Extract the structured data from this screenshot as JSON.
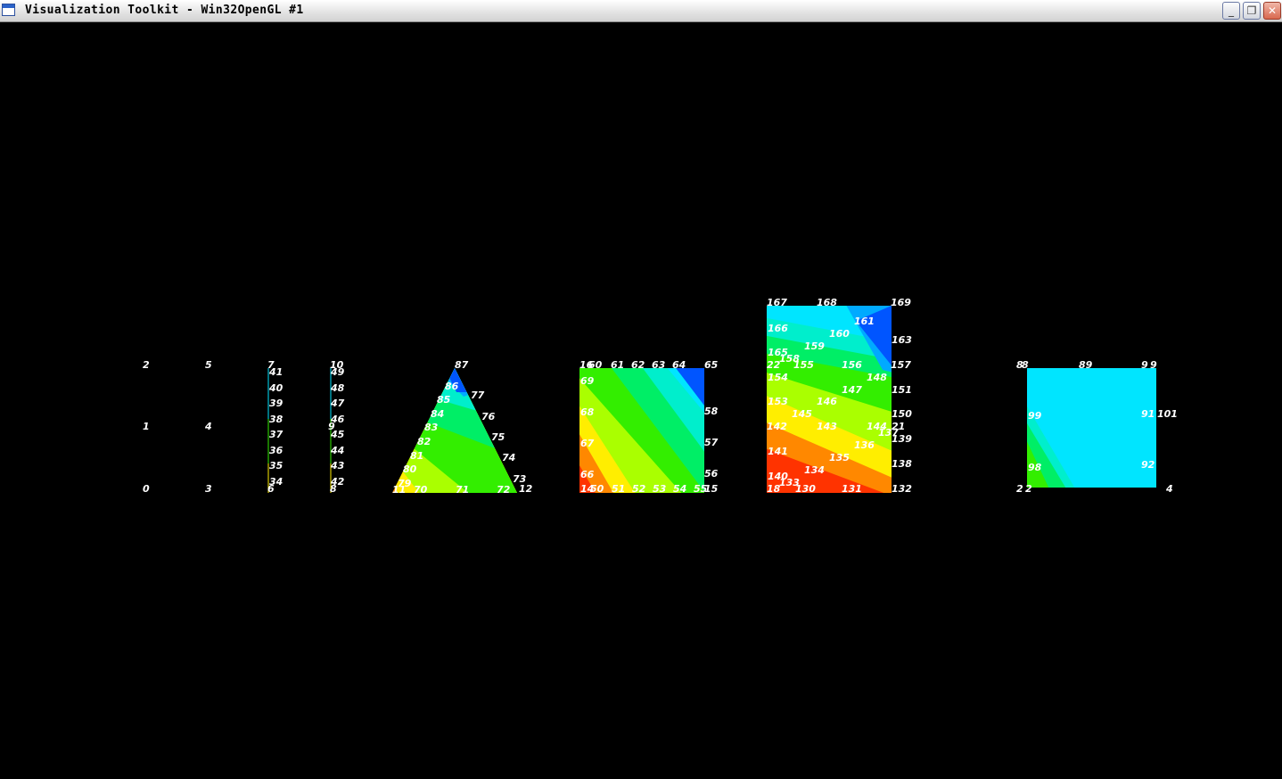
{
  "window": {
    "title": "Visualization Toolkit - Win32OpenGL #1",
    "minimize_glyph": "_",
    "restore_glyph": "❐",
    "close_glyph": "✕"
  },
  "scene": {
    "background": "#000000",
    "label_color": "#ffffff",
    "colors": {
      "red": "#ff3300",
      "orange": "#ff8800",
      "yellow": "#ffee00",
      "lime": "#aaff00",
      "green": "#33ee00",
      "spring": "#00ee66",
      "aqua": "#00eecc",
      "cyan": "#00e5ff",
      "sky": "#00aaff",
      "blue": "#0055ff"
    },
    "vertex_groups": {
      "col1": [
        "2",
        "1",
        "0"
      ],
      "col2": [
        "5",
        "4",
        "3"
      ],
      "line3": [
        "7",
        "41",
        "40",
        "39",
        "38",
        "37",
        "36",
        "35",
        "34",
        "6"
      ],
      "line4": [
        "10",
        "49",
        "48",
        "47",
        "46",
        "9",
        "45",
        "44",
        "43",
        "42",
        "8"
      ]
    },
    "triangle_labels": [
      "87",
      "86",
      "77",
      "85",
      "76",
      "84",
      "83",
      "75",
      "82",
      "81",
      "74",
      "80",
      "73",
      "79",
      "11",
      "70",
      "71",
      "72",
      "12"
    ],
    "square_labels": [
      "16",
      "60",
      "61",
      "62",
      "63",
      "64",
      "65",
      "69",
      "58",
      "68",
      "57",
      "67",
      "66",
      "56",
      "14",
      "50",
      "51",
      "52",
      "53",
      "54",
      "55",
      "15"
    ],
    "quad_labels": [
      "167",
      "168",
      "169",
      "166",
      "161",
      "160",
      "163",
      "165",
      "159",
      "22",
      "158",
      "155",
      "156",
      "157",
      "154",
      "148",
      "147",
      "151",
      "153",
      "146",
      "145",
      "143",
      "150",
      "142",
      "144",
      "21",
      "139",
      "137",
      "136",
      "141",
      "135",
      "138",
      "134",
      "140",
      "133",
      "18",
      "130",
      "131",
      "132"
    ],
    "box_labels": [
      "8",
      "89",
      "9",
      "99",
      "91",
      "101",
      "98",
      "92",
      "2",
      "4"
    ]
  }
}
